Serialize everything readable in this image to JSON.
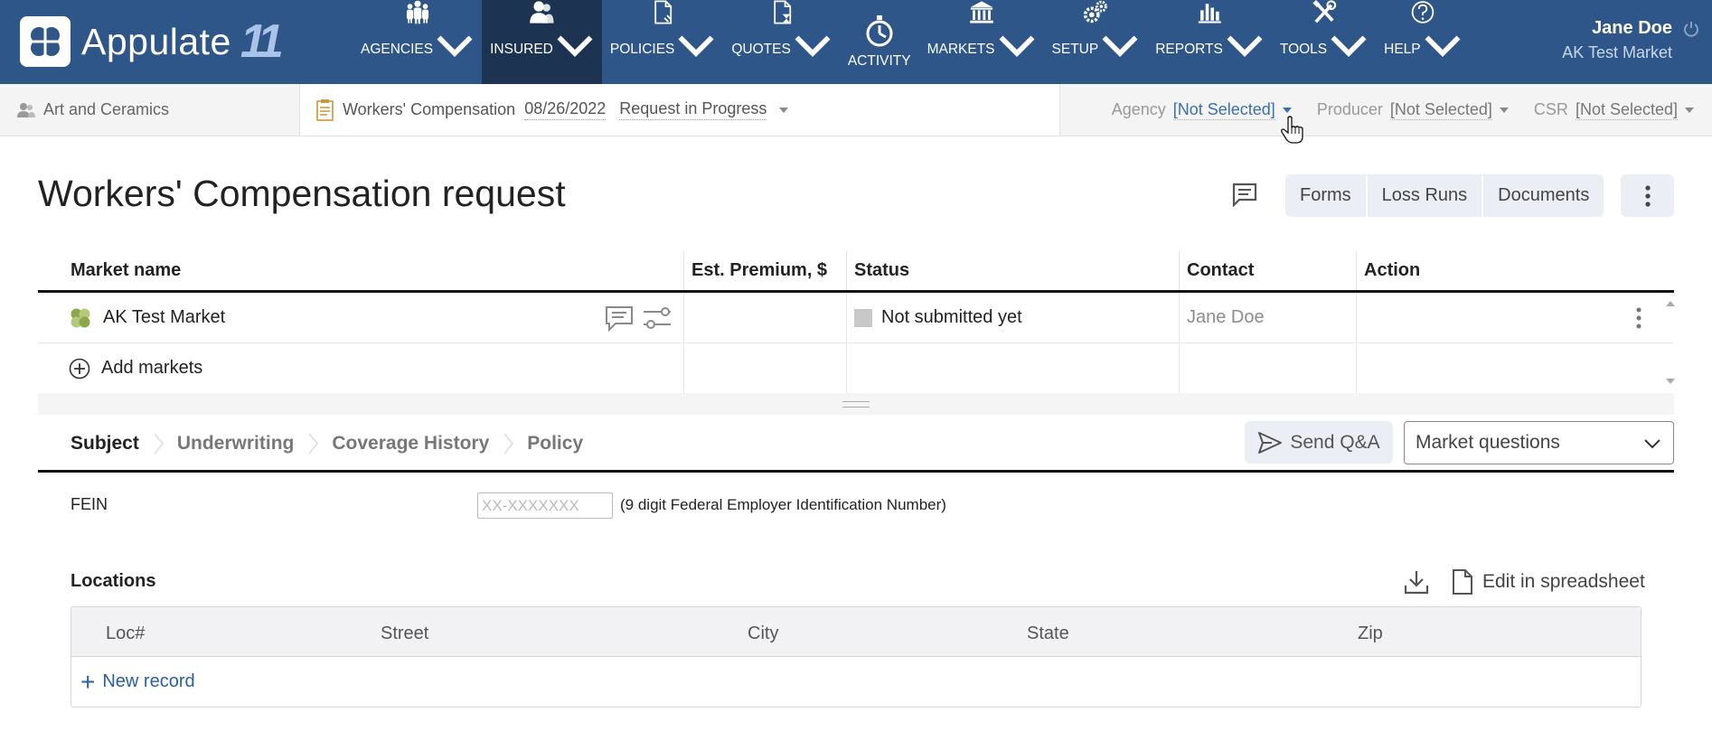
{
  "app": {
    "name": "Appulate",
    "version": "11"
  },
  "nav": {
    "items": [
      {
        "label": "AGENCIES",
        "icon": "agencies-icon",
        "dropdown": true,
        "active": false
      },
      {
        "label": "INSURED",
        "icon": "insured-icon",
        "dropdown": true,
        "active": true
      },
      {
        "label": "POLICIES",
        "icon": "policies-icon",
        "dropdown": true,
        "active": false
      },
      {
        "label": "QUOTES",
        "icon": "quotes-icon",
        "dropdown": true,
        "active": false
      },
      {
        "label": "ACTIVITY",
        "icon": "activity-icon",
        "dropdown": false,
        "active": false
      },
      {
        "label": "MARKETS",
        "icon": "markets-icon",
        "dropdown": true,
        "active": false
      },
      {
        "label": "SETUP",
        "icon": "setup-icon",
        "dropdown": true,
        "active": false
      },
      {
        "label": "REPORTS",
        "icon": "reports-icon",
        "dropdown": true,
        "active": false
      },
      {
        "label": "TOOLS",
        "icon": "tools-icon",
        "dropdown": true,
        "active": false
      },
      {
        "label": "HELP",
        "icon": "help-icon",
        "dropdown": true,
        "active": false
      }
    ]
  },
  "user": {
    "name": "Jane Doe",
    "market": "AK Test Market"
  },
  "subbar": {
    "insured": "Art and Ceramics",
    "policy_type": "Workers' Compensation",
    "date": "08/26/2022",
    "status": "Request in Progress",
    "agency_label": "Agency",
    "agency_value": "[Not Selected]",
    "producer_label": "Producer",
    "producer_value": "[Not Selected]",
    "csr_label": "CSR",
    "csr_value": "[Not Selected]"
  },
  "page": {
    "title": "Workers' Compensation request",
    "buttons": {
      "forms": "Forms",
      "loss_runs": "Loss Runs",
      "documents": "Documents"
    }
  },
  "markets_table": {
    "columns": [
      "Market name",
      "Est. Premium, $",
      "Status",
      "Contact",
      "Action"
    ],
    "rows": [
      {
        "market": "AK Test Market",
        "premium": "",
        "status": "Not submitted yet",
        "contact": "Jane Doe",
        "action": ""
      }
    ],
    "add_label": "Add markets"
  },
  "sections": {
    "tabs": [
      "Subject",
      "Underwriting",
      "Coverage History",
      "Policy"
    ],
    "active": "Subject",
    "send_qa": "Send Q&A",
    "market_questions": "Market questions"
  },
  "fein": {
    "label": "FEIN",
    "placeholder": "XX-XXXXXXX",
    "value": "",
    "hint": "(9 digit Federal Employer Identification Number)"
  },
  "locations": {
    "title": "Locations",
    "edit_label": "Edit in spreadsheet",
    "columns": [
      "Loc#",
      "Street",
      "City",
      "State",
      "Zip"
    ],
    "new_record": "New record"
  },
  "colors": {
    "nav_bg": "#2f5688",
    "nav_active": "#1d3352",
    "link": "#2a5ea5",
    "button_bg": "#eceef5"
  }
}
